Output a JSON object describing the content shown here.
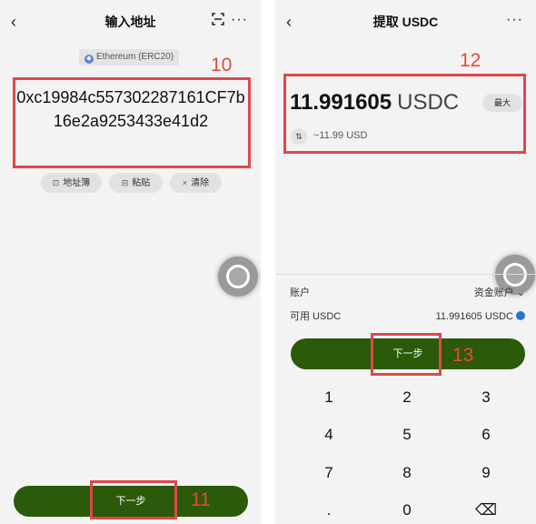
{
  "left": {
    "title": "输入地址",
    "back_icon": "‹",
    "more_icon": "···",
    "network_chip": "Ethereum (ERC20)",
    "address": "0xc19984c557302287161CF7b16e2a9253433e41d2",
    "annotation_address": "10",
    "actions": [
      {
        "icon": "⊡",
        "label": "地址簿"
      },
      {
        "icon": "⊟",
        "label": "粘贴"
      },
      {
        "icon": "×",
        "label": "清除"
      }
    ],
    "next_label": "下一步",
    "annotation_next": "11"
  },
  "right": {
    "title": "提取 USDC",
    "back_icon": "‹",
    "more_icon": "···",
    "amount": "11.991605",
    "currency": "USDC",
    "max_label": "最大",
    "swap_icon": "⇅",
    "fiat_value": "~11.99 USD",
    "annotation_amount": "12",
    "account_label": "账户",
    "account_value": "资金账户 ⌄",
    "available_label": "可用 USDC",
    "available_value": "11.991605 USDC",
    "next_label": "下一步",
    "annotation_next": "13",
    "keys": [
      "1",
      "2",
      "3",
      "4",
      "5",
      "6",
      "7",
      "8",
      "9",
      ".",
      "0",
      "⌫"
    ]
  },
  "colors": {
    "accent_green": "#2b5a0a",
    "annotation_red": "#e0474c",
    "background": "#f3f3f3"
  }
}
